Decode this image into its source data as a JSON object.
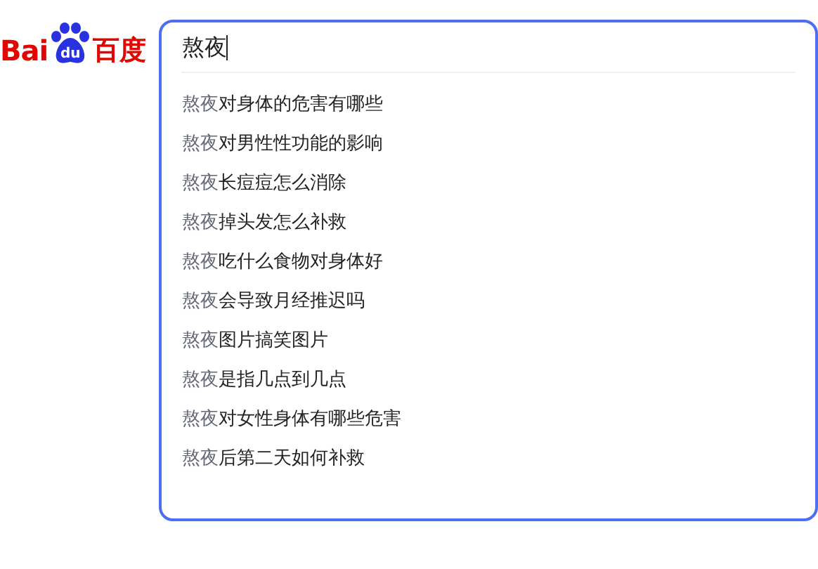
{
  "logo": {
    "left": "Bai",
    "badge": "du",
    "right": "百度"
  },
  "search": {
    "value": "熬夜"
  },
  "suggestions": [
    {
      "prefix": "熬夜",
      "rest": "对身体的危害有哪些"
    },
    {
      "prefix": "熬夜",
      "rest": "对男性性功能的影响"
    },
    {
      "prefix": "熬夜",
      "rest": "长痘痘怎么消除"
    },
    {
      "prefix": "熬夜",
      "rest": "掉头发怎么补救"
    },
    {
      "prefix": "熬夜",
      "rest": "吃什么食物对身体好"
    },
    {
      "prefix": "熬夜",
      "rest": "会导致月经推迟吗"
    },
    {
      "prefix": "熬夜",
      "rest": "图片搞笑图片"
    },
    {
      "prefix": "熬夜",
      "rest": "是指几点到几点"
    },
    {
      "prefix": "熬夜",
      "rest": "对女性身体有哪些危害"
    },
    {
      "prefix": "熬夜",
      "rest": "后第二天如何补救"
    }
  ]
}
